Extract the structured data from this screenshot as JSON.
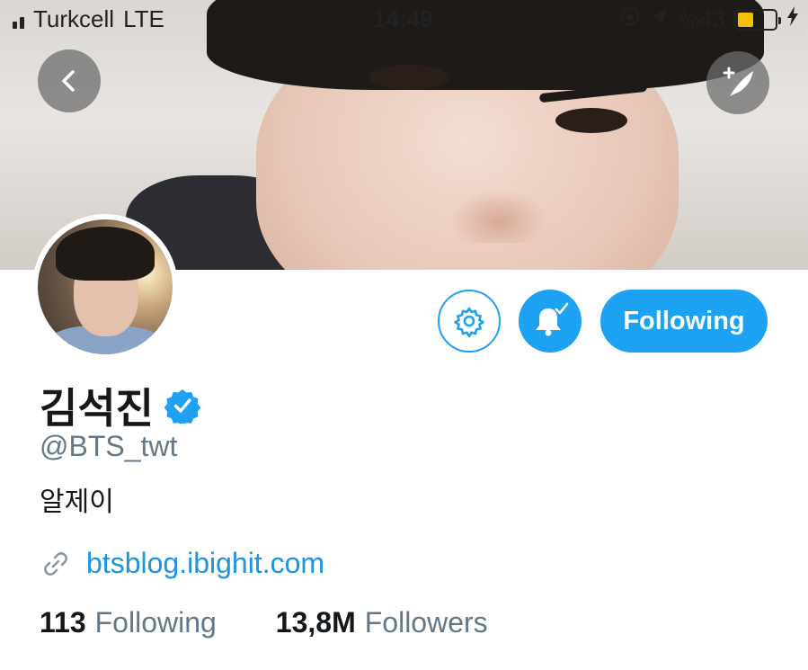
{
  "status_bar": {
    "carrier": "Turkcell",
    "network": "LTE",
    "time": "14:49",
    "battery": "%43",
    "battery_level": 0.43,
    "battery_color": "#f3c300"
  },
  "header": {
    "back_icon": "chevron-left-icon",
    "compose_icon": "compose-tweet-icon"
  },
  "actions": {
    "settings_icon": "gear-icon",
    "notifications_icon": "bell-check-icon",
    "follow_label": "Following"
  },
  "profile": {
    "display_name": "김석진",
    "verified": true,
    "handle": "@BTS_twt",
    "bio": "알제이",
    "link": "btsblog.ibighit.com",
    "following_count": "113",
    "following_label": "Following",
    "followers_count": "13,8M",
    "followers_label": "Followers"
  },
  "colors": {
    "accent": "#1da1f2",
    "link": "#1b95e0",
    "secondary_text": "#657786"
  }
}
